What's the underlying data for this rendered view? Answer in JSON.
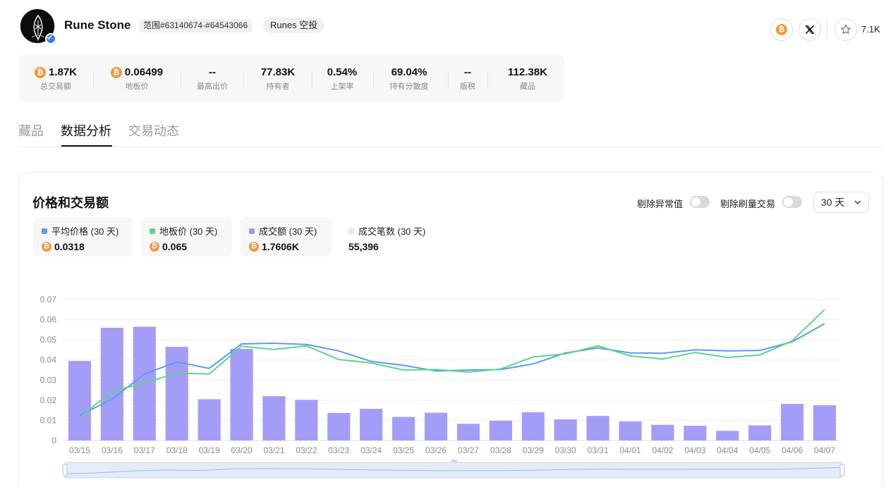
{
  "collection": {
    "name": "Rune Stone",
    "range": "范围#63140674-#64543066",
    "tag": "Runes 空投",
    "favorites": "7.1K"
  },
  "stats": [
    {
      "value": "1.87K",
      "label": "总交易额",
      "btc": true
    },
    {
      "value": "0.06499",
      "label": "地板价",
      "btc": true
    },
    {
      "value": "--",
      "label": "最高出价",
      "btc": false
    },
    {
      "value": "77.83K",
      "label": "持有者",
      "btc": false
    },
    {
      "value": "0.54%",
      "label": "上架率",
      "btc": false
    },
    {
      "value": "69.04%",
      "label": "持有分散度",
      "btc": false
    },
    {
      "value": "--",
      "label": "版税",
      "btc": false
    },
    {
      "value": "112.38K",
      "label": "藏品",
      "btc": false
    }
  ],
  "tabs": [
    "藏品",
    "数据分析",
    "交易动态"
  ],
  "active_tab": 1,
  "panel": {
    "title": "价格和交易额",
    "toggle_outliers": "剔除异常值",
    "toggle_wash": "剔除刷量交易",
    "range_value": "30 天"
  },
  "legend": [
    {
      "name": "平均价格 (30 天)",
      "value": "0.0318",
      "color": "#5b9bf0",
      "btc": true
    },
    {
      "name": "地板价 (30 天)",
      "value": "0.065",
      "color": "#5fd48a",
      "btc": true
    },
    {
      "name": "成交额 (30 天)",
      "value": "1.7606K",
      "color": "#9b97f5",
      "btc": true
    },
    {
      "name": "成交笔数 (30 天)",
      "value": "55,396",
      "color": "#e6e6e6",
      "btc": false
    }
  ],
  "colors": {
    "bar": "#a39df7",
    "avg_line": "#5b9bf0",
    "floor_line": "#5fd48a",
    "btc": "#f2973b"
  },
  "chart_data": {
    "type": "bar",
    "categories": [
      "03/15",
      "03/16",
      "03/17",
      "03/18",
      "03/19",
      "03/20",
      "03/21",
      "03/22",
      "03/23",
      "03/24",
      "03/25",
      "03/26",
      "03/27",
      "03/28",
      "03/29",
      "03/30",
      "03/31",
      "04/01",
      "04/02",
      "04/03",
      "04/04",
      "04/05",
      "04/06",
      "04/07"
    ],
    "ylim": [
      0,
      0.07
    ],
    "yticks": [
      "0",
      "0.01",
      "0.02",
      "0.03",
      "0.04",
      "0.05",
      "0.06",
      "0.07"
    ],
    "grid": true,
    "series": [
      {
        "name": "成交额 (30 天)",
        "type": "bar",
        "values": [
          0.0395,
          0.056,
          0.0565,
          0.0465,
          0.0205,
          0.0455,
          0.022,
          0.0202,
          0.0137,
          0.0157,
          0.0117,
          0.0138,
          0.0083,
          0.0098,
          0.014,
          0.0105,
          0.0122,
          0.0095,
          0.0078,
          0.0073,
          0.0048,
          0.0075,
          0.0182,
          0.0175
        ]
      },
      {
        "name": "平均价格 (30 天)",
        "type": "line",
        "values": [
          0.0125,
          0.0205,
          0.033,
          0.039,
          0.0358,
          0.048,
          0.0483,
          0.0477,
          0.0445,
          0.0393,
          0.0373,
          0.0345,
          0.035,
          0.0352,
          0.038,
          0.0435,
          0.046,
          0.0435,
          0.0433,
          0.045,
          0.0445,
          0.0447,
          0.049,
          0.058
        ]
      },
      {
        "name": "地板价 (30 天)",
        "type": "line",
        "values": [
          0.0115,
          0.0245,
          0.0285,
          0.0335,
          0.033,
          0.0468,
          0.0452,
          0.047,
          0.0402,
          0.0385,
          0.035,
          0.0352,
          0.034,
          0.0355,
          0.0415,
          0.043,
          0.047,
          0.042,
          0.0405,
          0.0437,
          0.0412,
          0.0425,
          0.0495,
          0.065
        ]
      }
    ]
  }
}
